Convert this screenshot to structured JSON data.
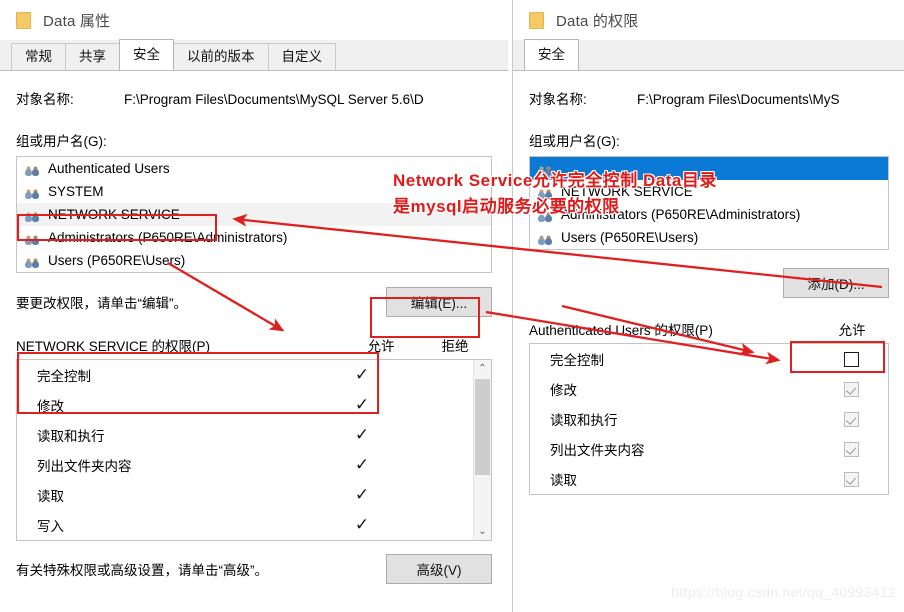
{
  "left_dialog": {
    "title": "Data 属性",
    "folder_icon": "folder-icon",
    "tabs": [
      {
        "label": "常规",
        "active": false
      },
      {
        "label": "共享",
        "active": false
      },
      {
        "label": "安全",
        "active": true
      },
      {
        "label": "以前的版本",
        "active": false
      },
      {
        "label": "自定义",
        "active": false
      }
    ],
    "object_name_label": "对象名称:",
    "object_name_value": "F:\\Program Files\\Documents\\MySQL Server 5.6\\D",
    "group_label": "组或用户名(G):",
    "users": [
      {
        "name": "Authenticated Users",
        "state": "normal"
      },
      {
        "name": "SYSTEM",
        "state": "normal"
      },
      {
        "name": "NETWORK SERVICE",
        "state": "hovered"
      },
      {
        "name": "Administrators (P650RE\\Administrators)",
        "state": "normal"
      },
      {
        "name": "Users (P650RE\\Users)",
        "state": "normal"
      }
    ],
    "edit_hint": "要更改权限，请单击“编辑”。",
    "edit_button": "编辑(E)...",
    "perm_title": "NETWORK SERVICE 的权限(P)",
    "perm_col_allow": "允许",
    "perm_col_deny": "拒绝",
    "permissions": [
      {
        "name": "完全控制",
        "allow": "check",
        "deny": ""
      },
      {
        "name": "修改",
        "allow": "check",
        "deny": ""
      },
      {
        "name": "读取和执行",
        "allow": "check",
        "deny": ""
      },
      {
        "name": "列出文件夹内容",
        "allow": "check",
        "deny": ""
      },
      {
        "name": "读取",
        "allow": "check",
        "deny": ""
      },
      {
        "name": "写入",
        "allow": "check",
        "deny": ""
      }
    ],
    "advanced_hint": "有关特殊权限或高级设置，请单击“高级”。",
    "advanced_button": "高级(V)",
    "check_glyph": "✓",
    "scroll_up_glyph": "⌃",
    "scroll_down_glyph": "⌄"
  },
  "right_dialog": {
    "title": "Data 的权限",
    "folder_icon": "folder-icon",
    "tabs": [
      {
        "label": "安全",
        "active": true
      }
    ],
    "object_name_label": "对象名称:",
    "object_name_value": "F:\\Program Files\\Documents\\MyS",
    "group_label": "组或用户名(G):",
    "users": [
      {
        "name": "",
        "state": "selected"
      },
      {
        "name": "NETWORK SERVICE",
        "state": "normal"
      },
      {
        "name": "Administrators (P650RE\\Administrators)",
        "state": "normal"
      },
      {
        "name": "Users (P650RE\\Users)",
        "state": "normal"
      }
    ],
    "add_button": "添加(D)...",
    "perm_title": "Authenticated Users 的权限(P)",
    "perm_col_allow": "允许",
    "permissions": [
      {
        "name": "完全控制",
        "allow": "empty"
      },
      {
        "name": "修改",
        "allow": "dim-check"
      },
      {
        "name": "读取和执行",
        "allow": "dim-check"
      },
      {
        "name": "列出文件夹内容",
        "allow": "dim-check"
      },
      {
        "name": "读取",
        "allow": "dim-check"
      }
    ]
  },
  "annotations": {
    "line1": "Network Service允许完全控制 Data目录",
    "line2": "是mysql启动服务必要的权限",
    "color": "#e01b1b",
    "boxes": [
      "network-service-row-box",
      "edit-button-box",
      "perm-fullcontrol-box",
      "add-button-box"
    ]
  },
  "watermark": "https://blog.csdn.net/qq_40993412"
}
